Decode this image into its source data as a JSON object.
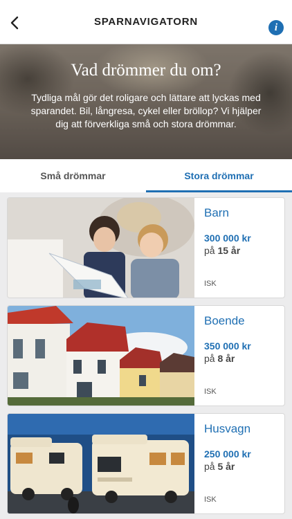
{
  "nav": {
    "title": "SPARNAVIGATORN",
    "info_glyph": "i"
  },
  "hero": {
    "title": "Vad drömmer du om?",
    "text": "Tydliga mål gör det roligare och lättare att lyckas med sparandet. Bil, långresa, cykel eller bröllop? Vi hjälper dig att förverkliga små och stora drömmar."
  },
  "tabs": [
    {
      "label": "Små drömmar",
      "active": false
    },
    {
      "label": "Stora drömmar",
      "active": true
    }
  ],
  "cards": [
    {
      "title": "Barn",
      "amount": "300 000 kr",
      "period_prefix": "på",
      "period_value": "15 år",
      "tag": "ISK"
    },
    {
      "title": "Boende",
      "amount": "350 000 kr",
      "period_prefix": "på",
      "period_value": "8 år",
      "tag": "ISK"
    },
    {
      "title": "Husvagn",
      "amount": "250 000 kr",
      "period_prefix": "på",
      "period_value": "5 år",
      "tag": "ISK"
    }
  ],
  "colors": {
    "accent": "#1f6fb3",
    "background": "#ececed"
  }
}
